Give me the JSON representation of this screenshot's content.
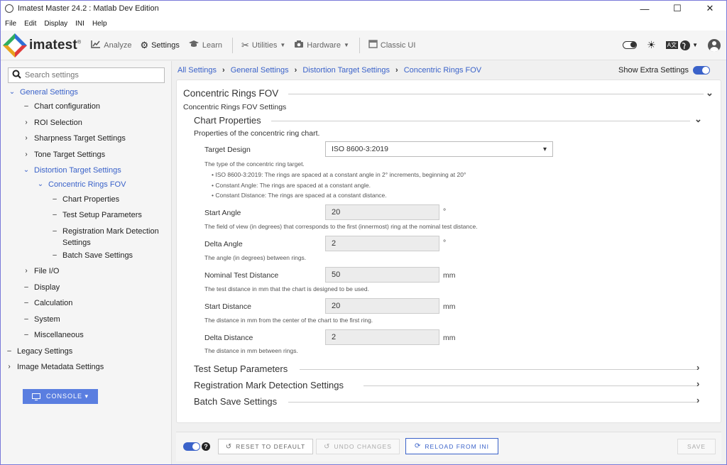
{
  "window": {
    "title": "Imatest Master 24.2 : Matlab Dev Edition",
    "controls": [
      "—",
      "☐",
      "✕"
    ]
  },
  "menu": [
    "File",
    "Edit",
    "Display",
    "INI",
    "Help"
  ],
  "toolbar": {
    "logo": "imatest",
    "logo_mark": "®",
    "analyze": "Analyze",
    "settings": "Settings",
    "learn": "Learn",
    "utilities": "Utilities",
    "hardware": "Hardware",
    "classic": "Classic UI"
  },
  "search": {
    "placeholder": "Search settings"
  },
  "tree": [
    {
      "label": "General Settings",
      "marker": "⌄",
      "link": true
    },
    {
      "label": "Chart configuration",
      "marker": "–",
      "link": false
    },
    {
      "label": "ROI Selection",
      "marker": "›",
      "link": false
    },
    {
      "label": "Sharpness Target Settings",
      "marker": "›",
      "link": false
    },
    {
      "label": "Tone Target Settings",
      "marker": "›",
      "link": false
    },
    {
      "label": "Distortion Target Settings",
      "marker": "⌄",
      "link": true
    },
    {
      "label": "Concentric Rings FOV",
      "marker": "⌄",
      "link": true
    },
    {
      "label": "Chart Properties",
      "marker": "–",
      "link": false
    },
    {
      "label": "Test Setup Parameters",
      "marker": "–",
      "link": false
    },
    {
      "label": "Registration Mark Detection",
      "marker": "–",
      "link": false
    },
    {
      "label": "Settings",
      "marker": "",
      "link": false
    },
    {
      "label": "Batch Save Settings",
      "marker": "–",
      "link": false
    },
    {
      "label": "File I/O",
      "marker": "›",
      "link": false
    },
    {
      "label": "Display",
      "marker": "–",
      "link": false
    },
    {
      "label": "Calculation",
      "marker": "–",
      "link": false
    },
    {
      "label": "System",
      "marker": "–",
      "link": false
    },
    {
      "label": "Miscellaneous",
      "marker": "–",
      "link": false
    },
    {
      "label": "Legacy Settings",
      "marker": "–",
      "link": false
    },
    {
      "label": "Image Metadata Settings",
      "marker": "›",
      "link": false
    }
  ],
  "console": {
    "label": "CONSOLE ▾"
  },
  "breadcrumbs": [
    "All Settings",
    "General Settings",
    "Distortion Target Settings",
    "Concentric Rings FOV"
  ],
  "extra_settings": {
    "label": "Show Extra Settings",
    "on": true
  },
  "section": {
    "title": "Concentric Rings FOV",
    "subtitle": "Concentric Rings FOV Settings",
    "group_title": "Chart Properties",
    "group_desc": "Properties of the concentric ring chart.",
    "target_design": {
      "label": "Target Design",
      "value": "ISO 8600-3:2019",
      "desc": "The type of the concentric ring target.",
      "bullets": [
        "ISO 8600-3:2019: The rings are spaced at a constant angle in 2° increments, beginning at 20°",
        "Constant Angle: The rings are spaced at a constant angle.",
        "Constant Distance: The rings are spaced at a constant distance."
      ]
    },
    "fields": [
      {
        "label": "Start Angle",
        "value": "20",
        "unit": "°",
        "desc": "The field of view (in degrees) that corresponds to the first (innermost) ring at the nominal test distance."
      },
      {
        "label": "Delta Angle",
        "value": "2",
        "unit": "°",
        "desc": "The angle (in degrees) between rings."
      },
      {
        "label": "Nominal Test Distance",
        "value": "50",
        "unit": "mm",
        "desc": "The test distance in mm that the chart is designed to be used."
      },
      {
        "label": "Start Distance",
        "value": "20",
        "unit": "mm",
        "desc": "The distance in mm from the center of the chart to the first ring."
      },
      {
        "label": "Delta Distance",
        "value": "2",
        "unit": "mm",
        "desc": "The distance in mm between rings."
      }
    ],
    "collapsed": [
      "Test Setup Parameters",
      "Registration Mark Detection Settings",
      "Batch Save Settings"
    ]
  },
  "footer": {
    "reset": "RESET TO DEFAULT",
    "undo": "UNDO CHANGES",
    "reload": "RELOAD FROM INI",
    "save": "SAVE"
  }
}
